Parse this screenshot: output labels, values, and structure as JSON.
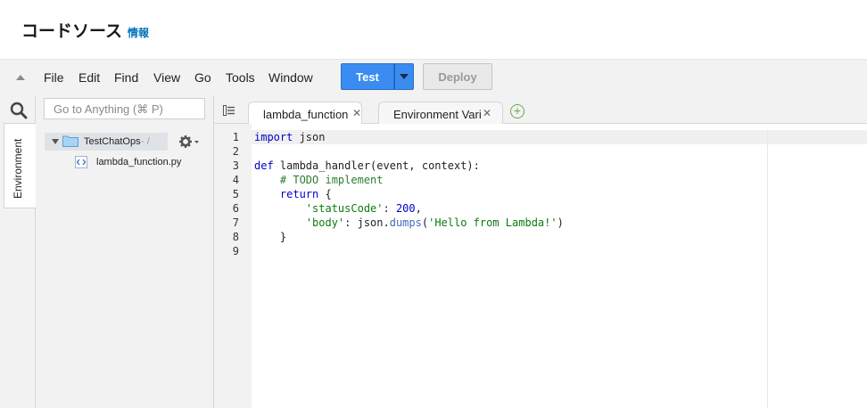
{
  "header": {
    "title": "コードソース",
    "info_link": "情報"
  },
  "menubar": {
    "items": [
      "File",
      "Edit",
      "Find",
      "View",
      "Go",
      "Tools",
      "Window"
    ],
    "test_label": "Test",
    "deploy_label": "Deploy"
  },
  "sidebar": {
    "environment_tab": "Environment",
    "goto_placeholder": "Go to Anything (⌘ P)",
    "folder_name": "TestChatOps",
    "folder_path": "- /",
    "file_name": "lambda_function.py"
  },
  "tabs": [
    {
      "label": "lambda_function",
      "active": true
    },
    {
      "label": "Environment Vari",
      "active": false
    }
  ],
  "editor": {
    "line_numbers": [
      "1",
      "2",
      "3",
      "4",
      "5",
      "6",
      "7",
      "8",
      "9"
    ],
    "lines": [
      "import json",
      "",
      "def lambda_handler(event, context):",
      "    # TODO implement",
      "    return {",
      "        'statusCode': 200,",
      "        'body': json.dumps('Hello from Lambda!')",
      "    }",
      ""
    ]
  },
  "colors": {
    "accent": "#3b8cf0",
    "link": "#0073bb",
    "comment": "#2e7d32",
    "keyword": "#0000c8"
  }
}
